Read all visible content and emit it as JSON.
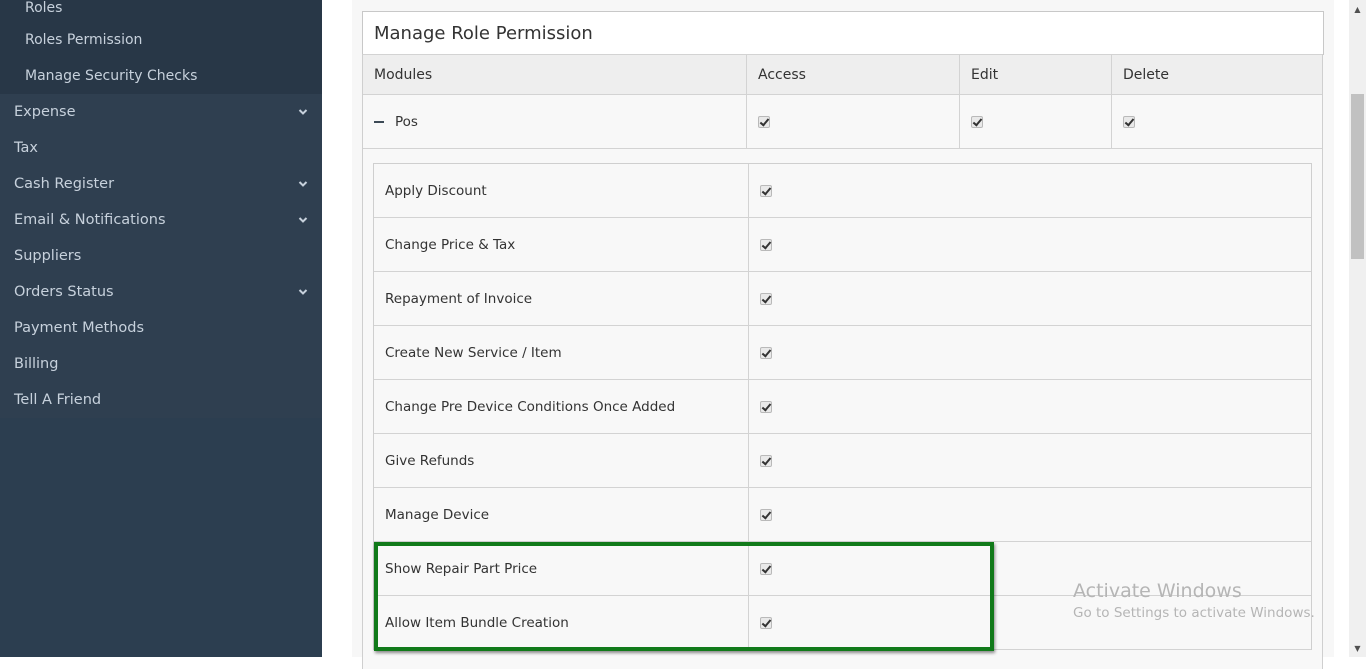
{
  "sidebar": {
    "submenu": [
      {
        "label": "Roles"
      },
      {
        "label": "Roles Permission"
      },
      {
        "label": "Manage Security Checks"
      }
    ],
    "items": [
      {
        "label": "Expense",
        "has_children": true
      },
      {
        "label": "Tax",
        "has_children": false
      },
      {
        "label": "Cash Register",
        "has_children": true
      },
      {
        "label": "Email & Notifications",
        "has_children": true
      },
      {
        "label": "Suppliers",
        "has_children": false
      },
      {
        "label": "Orders Status",
        "has_children": true
      },
      {
        "label": "Payment Methods",
        "has_children": false
      },
      {
        "label": "Billing",
        "has_children": false
      },
      {
        "label": "Tell A Friend",
        "has_children": false
      }
    ]
  },
  "panel": {
    "title": "Manage Role Permission",
    "columns": [
      "Modules",
      "Access",
      "Edit",
      "Delete"
    ],
    "module": {
      "name": "Pos",
      "expanded": true,
      "access": true,
      "edit": true,
      "delete": true
    },
    "sub_permissions": [
      {
        "label": "Apply Discount",
        "checked": true
      },
      {
        "label": "Change Price & Tax",
        "checked": true
      },
      {
        "label": "Repayment of Invoice",
        "checked": true
      },
      {
        "label": "Create New Service / Item",
        "checked": true
      },
      {
        "label": "Change Pre Device Conditions Once Added",
        "checked": true
      },
      {
        "label": "Give Refunds",
        "checked": true
      },
      {
        "label": "Manage Device",
        "checked": true
      },
      {
        "label": "Show Repair Part Price",
        "checked": true
      },
      {
        "label": "Allow Item Bundle Creation",
        "checked": true
      }
    ],
    "highlight_color": "#117a1a"
  },
  "watermark": {
    "line1": "Activate Windows",
    "line2": "Go to Settings to activate Windows."
  },
  "colors": {
    "sidebar_bg": "#2f3f50",
    "submenu_bg": "#283747",
    "sidebar_text": "#c7d1dc"
  }
}
